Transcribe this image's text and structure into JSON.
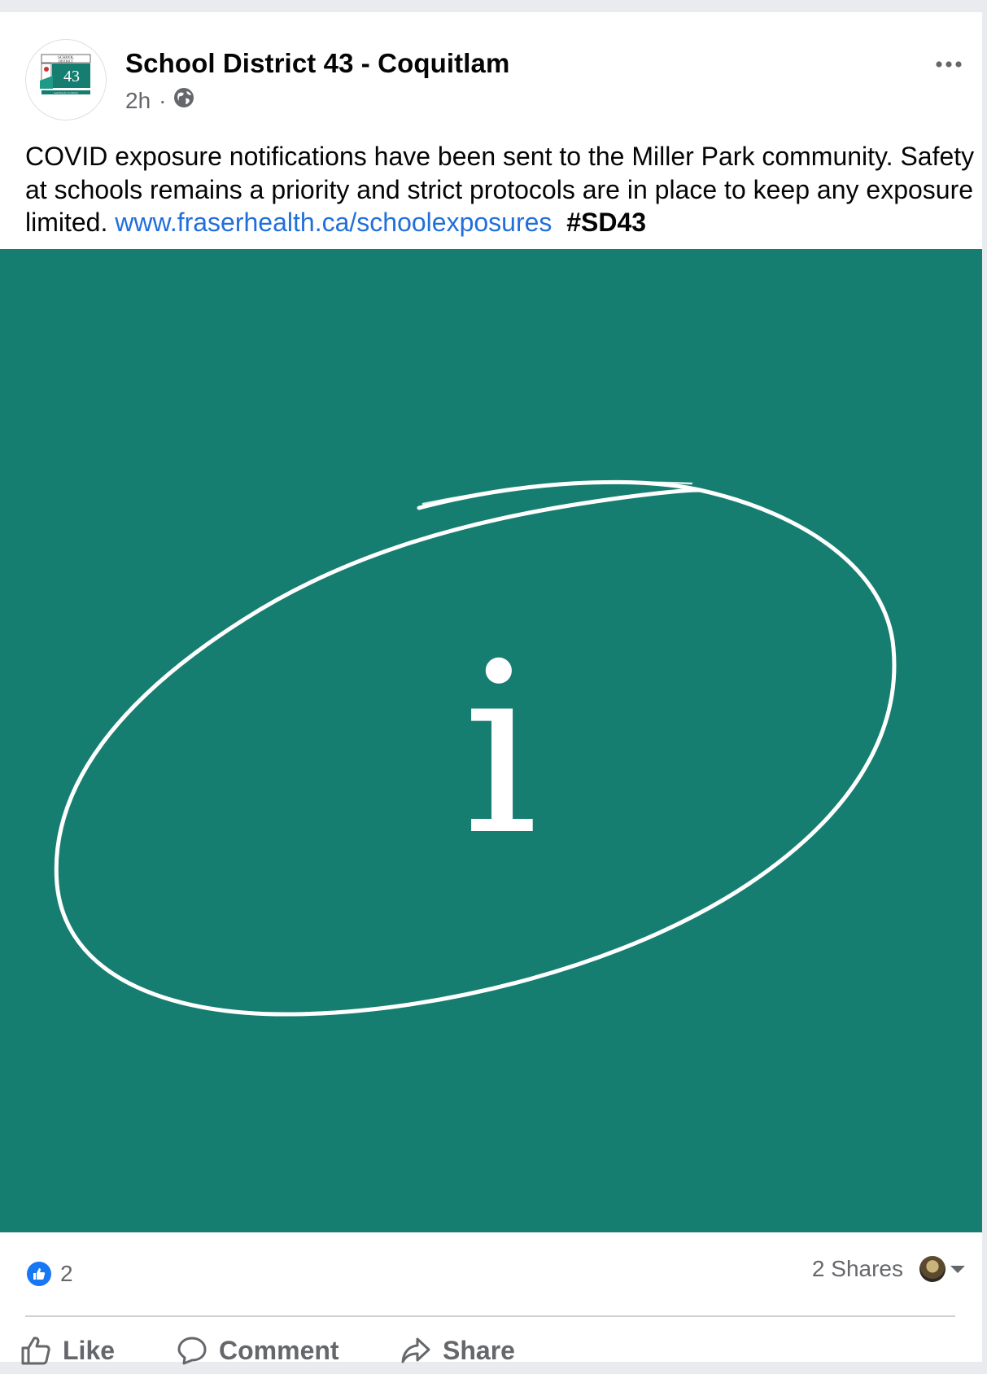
{
  "post": {
    "author": "School District 43 - Coquitlam",
    "timestamp": "2h",
    "separator": "·",
    "privacy_icon": "globe-icon",
    "more_icon": "more-options-icon",
    "avatar": {
      "logo_lines": [
        "SCHOOL",
        "DISTRICT"
      ],
      "number": "43",
      "tagline": "Learning for a Lifetime"
    },
    "text": "COVID exposure notifications have been sent to the Miller Park community. Safety at schools remains a priority and strict protocols are in place to keep any exposure limited.",
    "link": "www.fraserhealth.ca/schoolexposures",
    "hashtag": "#SD43",
    "image": {
      "glyph": "i",
      "background_color": "#167d71",
      "stroke_color": "#ffffff"
    }
  },
  "engagement": {
    "like_count": "2",
    "shares": "2 Shares",
    "reaction_icon": "thumbs-up-icon"
  },
  "actions": {
    "like": "Like",
    "comment": "Comment",
    "share": "Share"
  },
  "colors": {
    "link": "#216fdb",
    "secondary_text": "#65676b",
    "like_blue": "#1877f2"
  }
}
